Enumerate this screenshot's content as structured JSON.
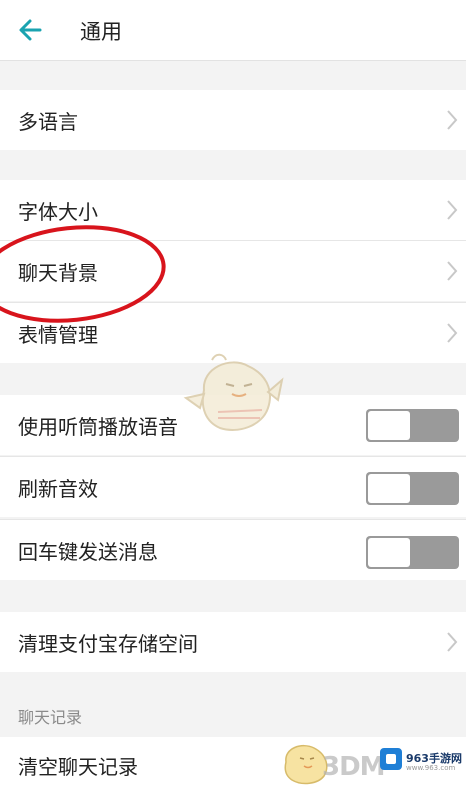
{
  "header": {
    "title": "通用",
    "back_icon": "arrow-left-icon"
  },
  "groups": {
    "language": {
      "label": "多语言"
    },
    "font_size": {
      "label": "字体大小"
    },
    "chat_background": {
      "label": "聊天背景"
    },
    "emoji_management": {
      "label": "表情管理"
    },
    "earpiece_audio": {
      "label": "使用听筒播放语音",
      "enabled": false
    },
    "refresh_sound": {
      "label": "刷新音效",
      "enabled": false
    },
    "enter_to_send": {
      "label": "回车键发送消息",
      "enabled": false
    },
    "clear_storage": {
      "label": "清理支付宝存储空间"
    }
  },
  "chat_history_section": {
    "heading": "聊天记录",
    "clear_label": "清空聊天记录"
  },
  "watermarks": {
    "brand_3dm": "3DM",
    "site_name": "963手游网",
    "site_url": "www.963.com"
  },
  "colors": {
    "accent": "#1aa3b0",
    "annotation_red": "#d8141c",
    "toggle_off": "#9a9a9a"
  }
}
